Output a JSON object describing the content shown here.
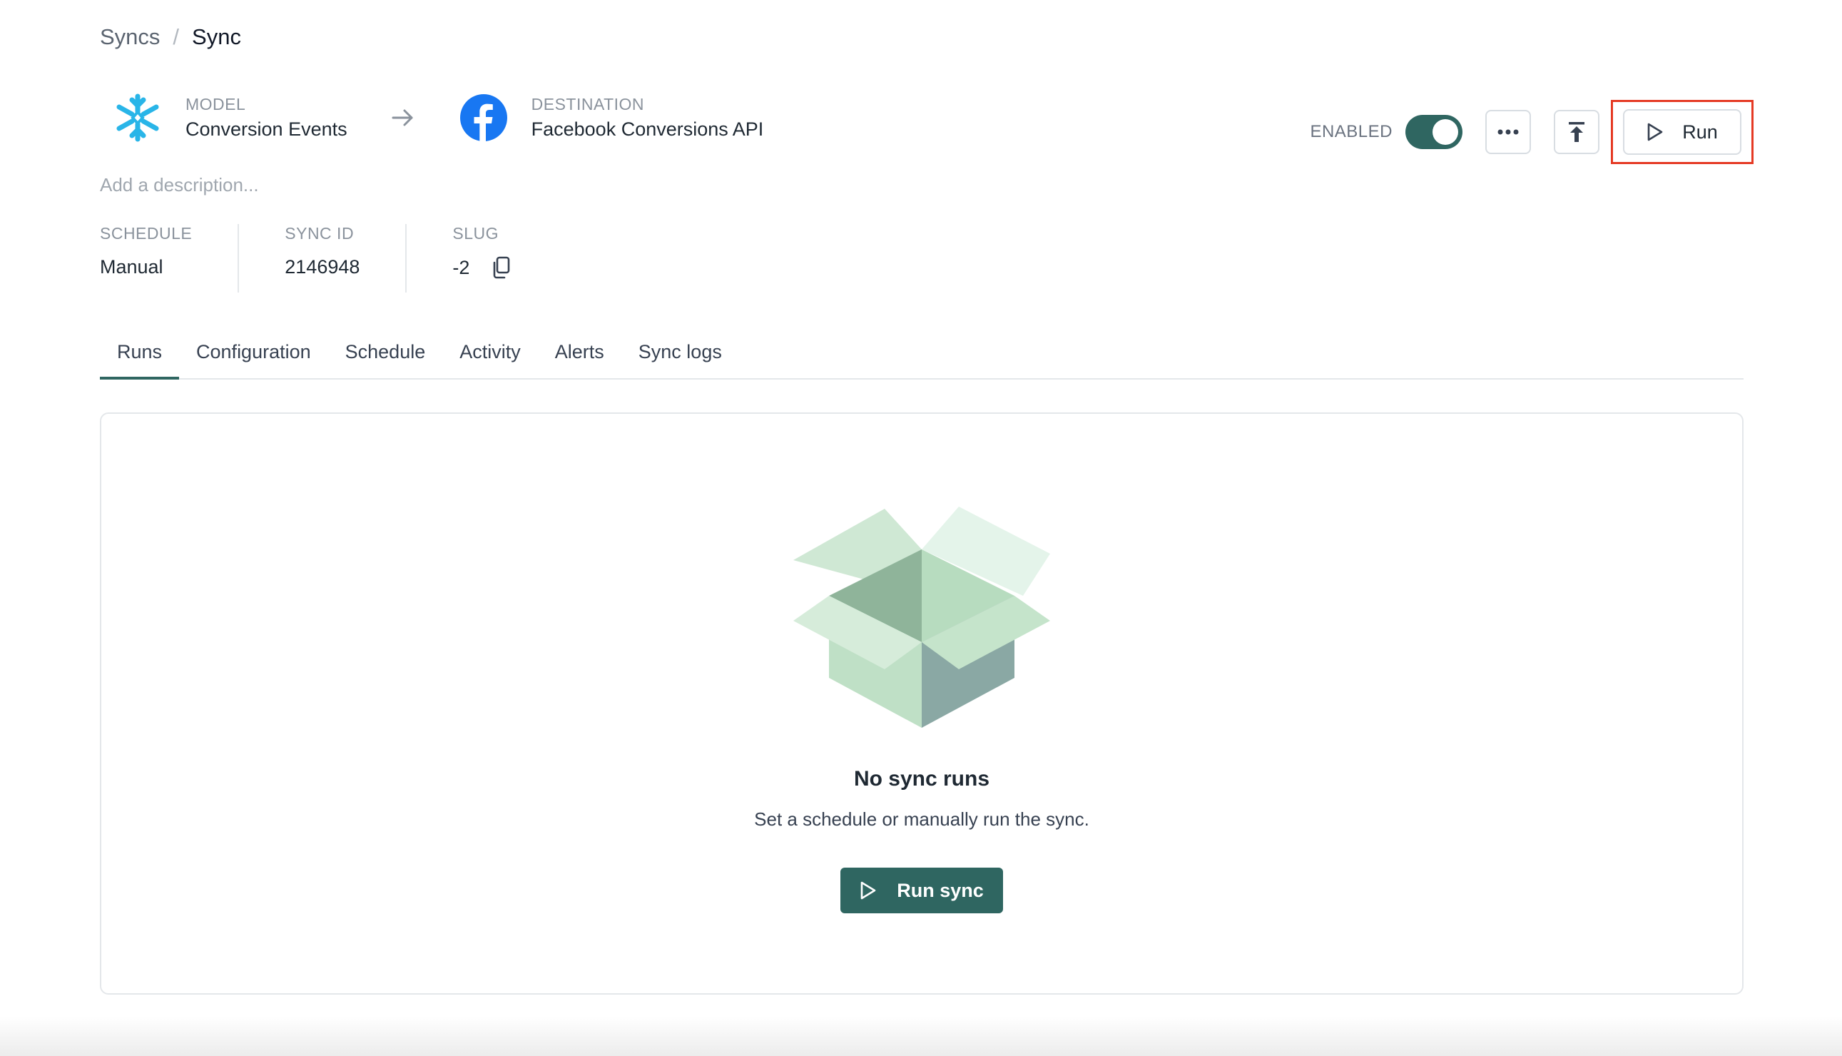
{
  "breadcrumb": {
    "parent": "Syncs",
    "separator": "/",
    "current": "Sync"
  },
  "model": {
    "kicker": "MODEL",
    "name": "Conversion Events",
    "icon": "snowflake-icon",
    "color": "#29B5E8"
  },
  "destination": {
    "kicker": "DESTINATION",
    "name": "Facebook Conversions API",
    "icon": "facebook-icon",
    "color": "#1877F2"
  },
  "controls": {
    "enabled_label": "ENABLED",
    "enabled": true,
    "run_label": "Run",
    "accent": "#2F6661",
    "highlight": "#E53A24"
  },
  "description_placeholder": "Add a description...",
  "meta": {
    "schedule_label": "SCHEDULE",
    "schedule_value": "Manual",
    "sync_id_label": "SYNC ID",
    "sync_id_value": "2146948",
    "slug_label": "SLUG",
    "slug_value": "-2"
  },
  "tabs": [
    {
      "label": "Runs",
      "active": true
    },
    {
      "label": "Configuration",
      "active": false
    },
    {
      "label": "Schedule",
      "active": false
    },
    {
      "label": "Activity",
      "active": false
    },
    {
      "label": "Alerts",
      "active": false
    },
    {
      "label": "Sync logs",
      "active": false
    }
  ],
  "empty_state": {
    "title": "No sync runs",
    "subtitle": "Set a schedule or manually run the sync.",
    "button_label": "Run sync",
    "illustration": "open-box-icon"
  }
}
